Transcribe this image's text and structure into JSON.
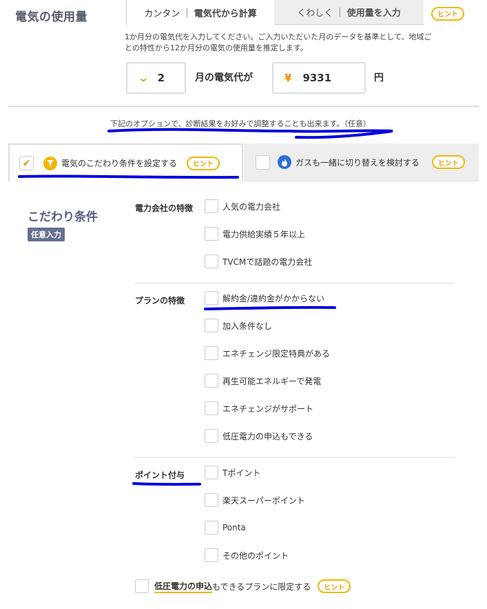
{
  "header": {
    "title": "電気の使用量",
    "tab_active": {
      "part1": "カンタン",
      "sep": "|",
      "part2": "電気代から計算"
    },
    "tab_inactive": {
      "part1": "くわしく",
      "sep": "|",
      "part2": "使用量を入力"
    },
    "hint_label": "ヒント"
  },
  "description": "1か月分の電気代を入力してください。ご入力いただいた月のデータを基準として、地域ごとの特性から12か月分の電気の使用量を推定します。",
  "input": {
    "month_value": "2",
    "month_label": "月の電気代が",
    "yen_symbol": "¥",
    "yen_value": "9331",
    "yen_unit": "円"
  },
  "option_note": "下記のオプションで、診断結果をお好みで調整することも出来ます。（任意）",
  "option_tabs": [
    {
      "label": "電気のこだわり条件を設定する",
      "checked": true,
      "hint": "ヒント"
    },
    {
      "label": "ガスも一緒に切り替えを検討する",
      "checked": false,
      "hint": "ヒント"
    }
  ],
  "conditions": {
    "title": "こだわり条件",
    "badge": "任意入力",
    "sections": [
      {
        "label": "電力会社の特徴",
        "items": [
          "人気の電力会社",
          "電力供給実績５年以上",
          "TVCMで話題の電力会社"
        ]
      },
      {
        "label": "プランの特徴",
        "items": [
          "解約金/違約金がかからない",
          "加入条件なし",
          "エネチェンジ限定特典がある",
          "再生可能エネルギーで発電",
          "エネチェンジがサポート",
          "低圧電力の申込もできる"
        ]
      },
      {
        "label": "ポイント付与",
        "items": [
          "Tポイント",
          "楽天スーパーポイント",
          "Ponta",
          "その他のポイント"
        ]
      }
    ],
    "bottom": {
      "underlined": "低圧電力の申込",
      "rest": "もできるプランに限定する",
      "hint": "ヒント"
    }
  },
  "colors": {
    "accent": "#f08c00",
    "hint_border": "#f2b705",
    "annotation": "#0000dd",
    "gas_icon": "#2a6fdb"
  },
  "icons": {
    "funnel": "funnel-icon",
    "flame": "flame-icon",
    "chevron": "chevron-down-icon",
    "check": "check-icon"
  }
}
